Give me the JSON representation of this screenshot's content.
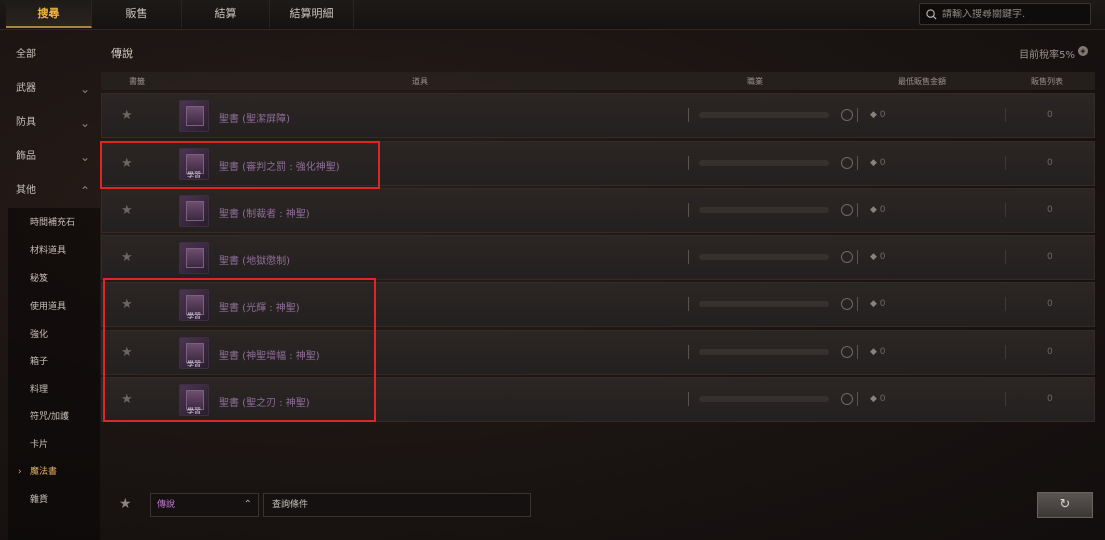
{
  "tabs": [
    "搜尋",
    "販售",
    "結算",
    "結算明細"
  ],
  "search": {
    "placeholder": "請輸入搜尋關鍵字."
  },
  "sidebar": {
    "categories": [
      {
        "label": "全部",
        "chevron": ""
      },
      {
        "label": "武器",
        "chevron": "⌄"
      },
      {
        "label": "防具",
        "chevron": "⌄"
      },
      {
        "label": "飾品",
        "chevron": "⌄"
      },
      {
        "label": "其他",
        "chevron": "⌃"
      }
    ],
    "subitems": [
      "時間補充石",
      "材料道具",
      "秘笈",
      "使用道具",
      "強化",
      "箱子",
      "料理",
      "符咒/加護",
      "卡片",
      "魔法書",
      "雜貨"
    ],
    "active_subitem": "魔法書"
  },
  "main": {
    "title": "傳說",
    "tax_rate": "目前稅率5%",
    "columns": {
      "bookmark": "書籤",
      "item": "道具",
      "job": "職業",
      "min_price": "最低販售金額",
      "listing": "販售列表"
    }
  },
  "rows": [
    {
      "name": "聖書 (聖潔屏障)",
      "price": "0",
      "count": "0",
      "learn": ""
    },
    {
      "name": "聖書 (審判之罰 : 強化神聖)",
      "price": "0",
      "count": "0",
      "learn": "學習"
    },
    {
      "name": "聖書 (制裁者 : 神聖)",
      "price": "0",
      "count": "0",
      "learn": ""
    },
    {
      "name": "聖書 (地獄懲制)",
      "price": "0",
      "count": "0",
      "learn": ""
    },
    {
      "name": "聖書 (光輝 : 神聖)",
      "price": "0",
      "count": "0",
      "learn": "學習"
    },
    {
      "name": "聖書 (神聖增幅 : 神聖)",
      "price": "0",
      "count": "0",
      "learn": "學習"
    },
    {
      "name": "聖書 (聖之刃 : 神聖)",
      "price": "0",
      "count": "0",
      "learn": "學習"
    }
  ],
  "bottom": {
    "grade_select": "傳說",
    "query": "查詢條件"
  },
  "colors": {
    "accent": "#f0b443",
    "item_name": "#8e6d98",
    "highlight": "#e02525"
  }
}
